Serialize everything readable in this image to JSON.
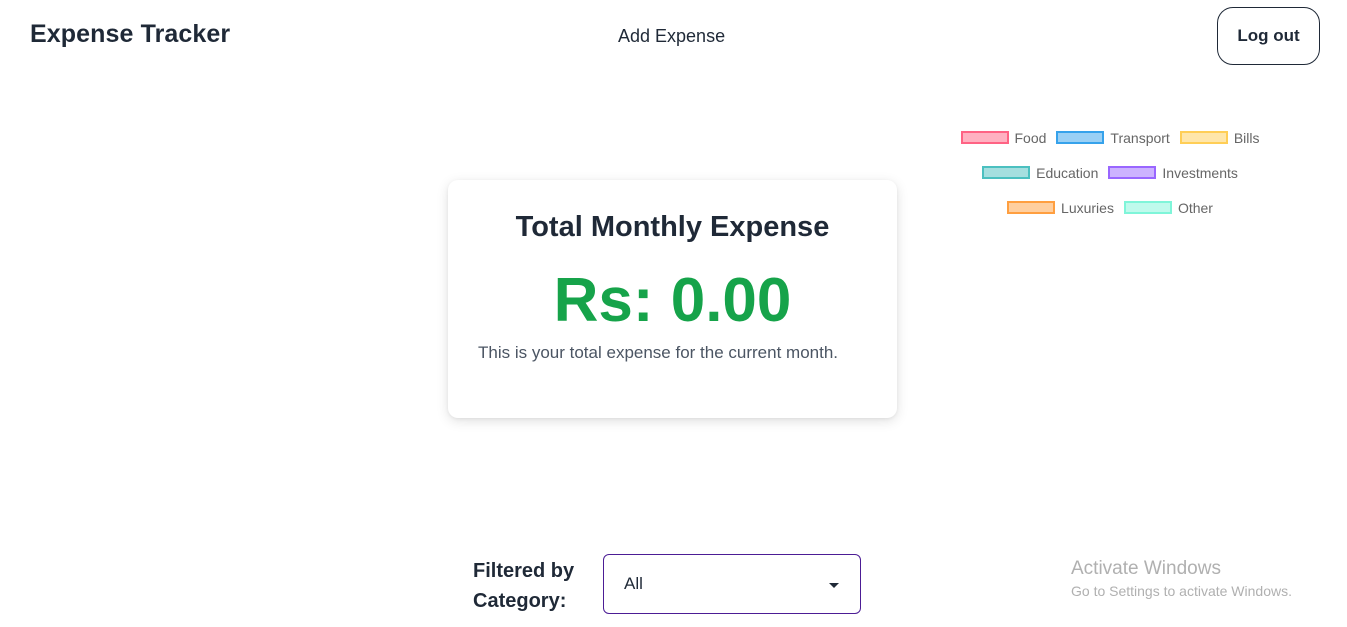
{
  "header": {
    "app_title": "Expense Tracker",
    "nav_add_expense": "Add Expense",
    "logout_label": "Log out"
  },
  "legend": {
    "items": [
      {
        "label": "Food",
        "color": "#ff6384",
        "fill": "rgba(255,99,132,0.5)"
      },
      {
        "label": "Transport",
        "color": "#36a2eb",
        "fill": "rgba(54,162,235,0.5)"
      },
      {
        "label": "Bills",
        "color": "#ffce56",
        "fill": "rgba(255,206,86,0.5)"
      },
      {
        "label": "Education",
        "color": "#4bc0c0",
        "fill": "rgba(75,192,192,0.5)"
      },
      {
        "label": "Investments",
        "color": "#9966ff",
        "fill": "rgba(153,102,255,0.5)"
      },
      {
        "label": "Luxuries",
        "color": "#ff9f40",
        "fill": "rgba(255,159,64,0.5)"
      },
      {
        "label": "Other",
        "color": "#7ff5d9",
        "fill": "rgba(127,245,217,0.5)"
      }
    ]
  },
  "summary": {
    "title": "Total Monthly Expense",
    "amount": "Rs: 0.00",
    "amount_color": "#16a34a",
    "description": "This is your total expense for the current month."
  },
  "filter": {
    "label_line1": "Filtered by",
    "label_line2": "Category:",
    "selected": "All"
  },
  "watermark": {
    "title": "Activate Windows",
    "subtitle": "Go to Settings to activate Windows."
  }
}
